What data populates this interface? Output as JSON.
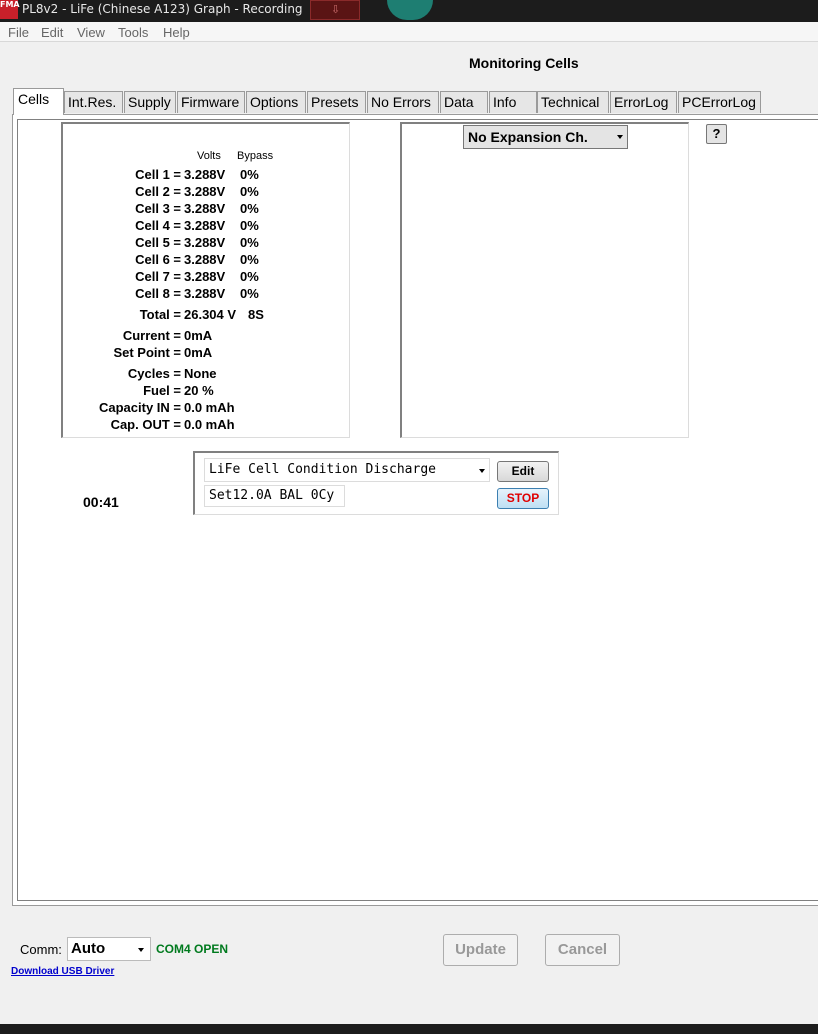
{
  "window": {
    "title": "PL8v2 - LiFe (Chinese A123) Graph - Recording",
    "icon_text": "FMA"
  },
  "menu": [
    "File",
    "Edit",
    "View",
    "Tools",
    "Help"
  ],
  "page_title": "Monitoring Cells",
  "tabs": [
    "Cells",
    "Int.Res.",
    "Supply",
    "Firmware",
    "Options",
    "Presets",
    "No Errors",
    "Data",
    "Info",
    "Technical",
    "ErrorLog",
    "PCErrorLog"
  ],
  "active_tab": "Cells",
  "cells": {
    "headers": {
      "volts": "Volts",
      "bypass": "Bypass"
    },
    "rows": [
      {
        "label": "Cell 1 =",
        "volts": "3.288V",
        "bypass": "0%"
      },
      {
        "label": "Cell 2 =",
        "volts": "3.288V",
        "bypass": "0%"
      },
      {
        "label": "Cell 3 =",
        "volts": "3.288V",
        "bypass": "0%"
      },
      {
        "label": "Cell 4 =",
        "volts": "3.288V",
        "bypass": "0%"
      },
      {
        "label": "Cell 5 =",
        "volts": "3.288V",
        "bypass": "0%"
      },
      {
        "label": "Cell 6 =",
        "volts": "3.288V",
        "bypass": "0%"
      },
      {
        "label": "Cell 7 =",
        "volts": "3.288V",
        "bypass": "0%"
      },
      {
        "label": "Cell 8 =",
        "volts": "3.288V",
        "bypass": "0%"
      }
    ],
    "total": {
      "label": "Total =",
      "value": "26.304 V",
      "count": "8S"
    },
    "stats": [
      {
        "label": "Current =",
        "value": "0mA"
      },
      {
        "label": "Set Point =",
        "value": "0mA"
      },
      {
        "label": "Cycles =",
        "value": "None"
      },
      {
        "label": "Fuel =",
        "value": "20 %"
      },
      {
        "label": "Capacity IN =",
        "value": "0.0 mAh"
      },
      {
        "label": "Cap. OUT =",
        "value": "0.0 mAh"
      }
    ]
  },
  "expansion": {
    "selected": "No Expansion Ch."
  },
  "help_label": "?",
  "timer": "00:41",
  "program": {
    "selected": "LiFe Cell Condition Discharge",
    "detail": "Set12.0A BAL 0Cy",
    "edit_label": "Edit",
    "stop_label": "STOP"
  },
  "footer": {
    "comm_label": "Comm:",
    "comm_value": "Auto",
    "com_status": "COM4 OPEN",
    "usb_link": "Download USB Driver",
    "update_label": "Update",
    "cancel_label": "Cancel"
  },
  "colors": {
    "titlebar": "#1c1c1c",
    "status_green": "#007a1e",
    "stop_red": "#e00000",
    "link_blue": "#0000cc"
  }
}
